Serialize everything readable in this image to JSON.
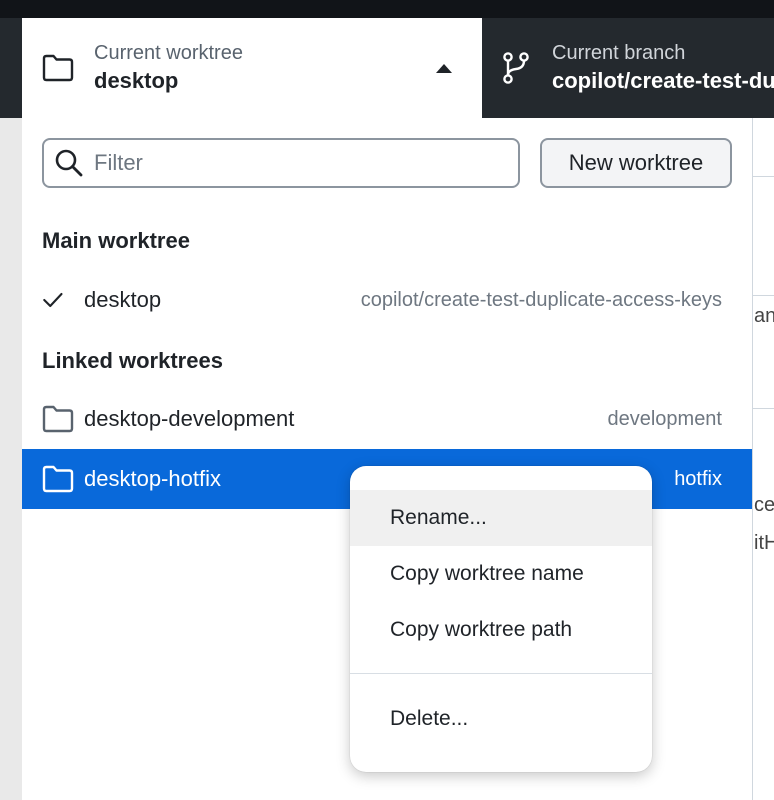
{
  "toolbar": {
    "worktree": {
      "caption": "Current worktree",
      "value": "desktop",
      "icon": "folder-icon"
    },
    "branch": {
      "caption": "Current branch",
      "value": "copilot/create-test-duplicate-access-keys",
      "icon": "git-branch-icon"
    }
  },
  "dropdown": {
    "filter": {
      "placeholder": "Filter",
      "value": ""
    },
    "new_worktree_label": "New worktree",
    "main_section": {
      "title": "Main worktree",
      "items": [
        {
          "name": "desktop",
          "branch": "copilot/create-test-duplicate-access-keys",
          "checked": true
        }
      ]
    },
    "linked_section": {
      "title": "Linked worktrees",
      "items": [
        {
          "name": "desktop-development",
          "branch": "development",
          "selected": false
        },
        {
          "name": "desktop-hotfix",
          "branch": "hotfix",
          "selected": true
        }
      ]
    }
  },
  "context_menu": {
    "items": [
      "Rename...",
      "Copy worktree name",
      "Copy worktree path"
    ],
    "danger_items": [
      "Delete..."
    ]
  },
  "background": {
    "fragments": [
      "an",
      "ce",
      "itH"
    ]
  },
  "colors": {
    "selected_row": "#0969da",
    "toolbar_dark": "#24292e",
    "menu_hover": "#f0f0f0"
  }
}
